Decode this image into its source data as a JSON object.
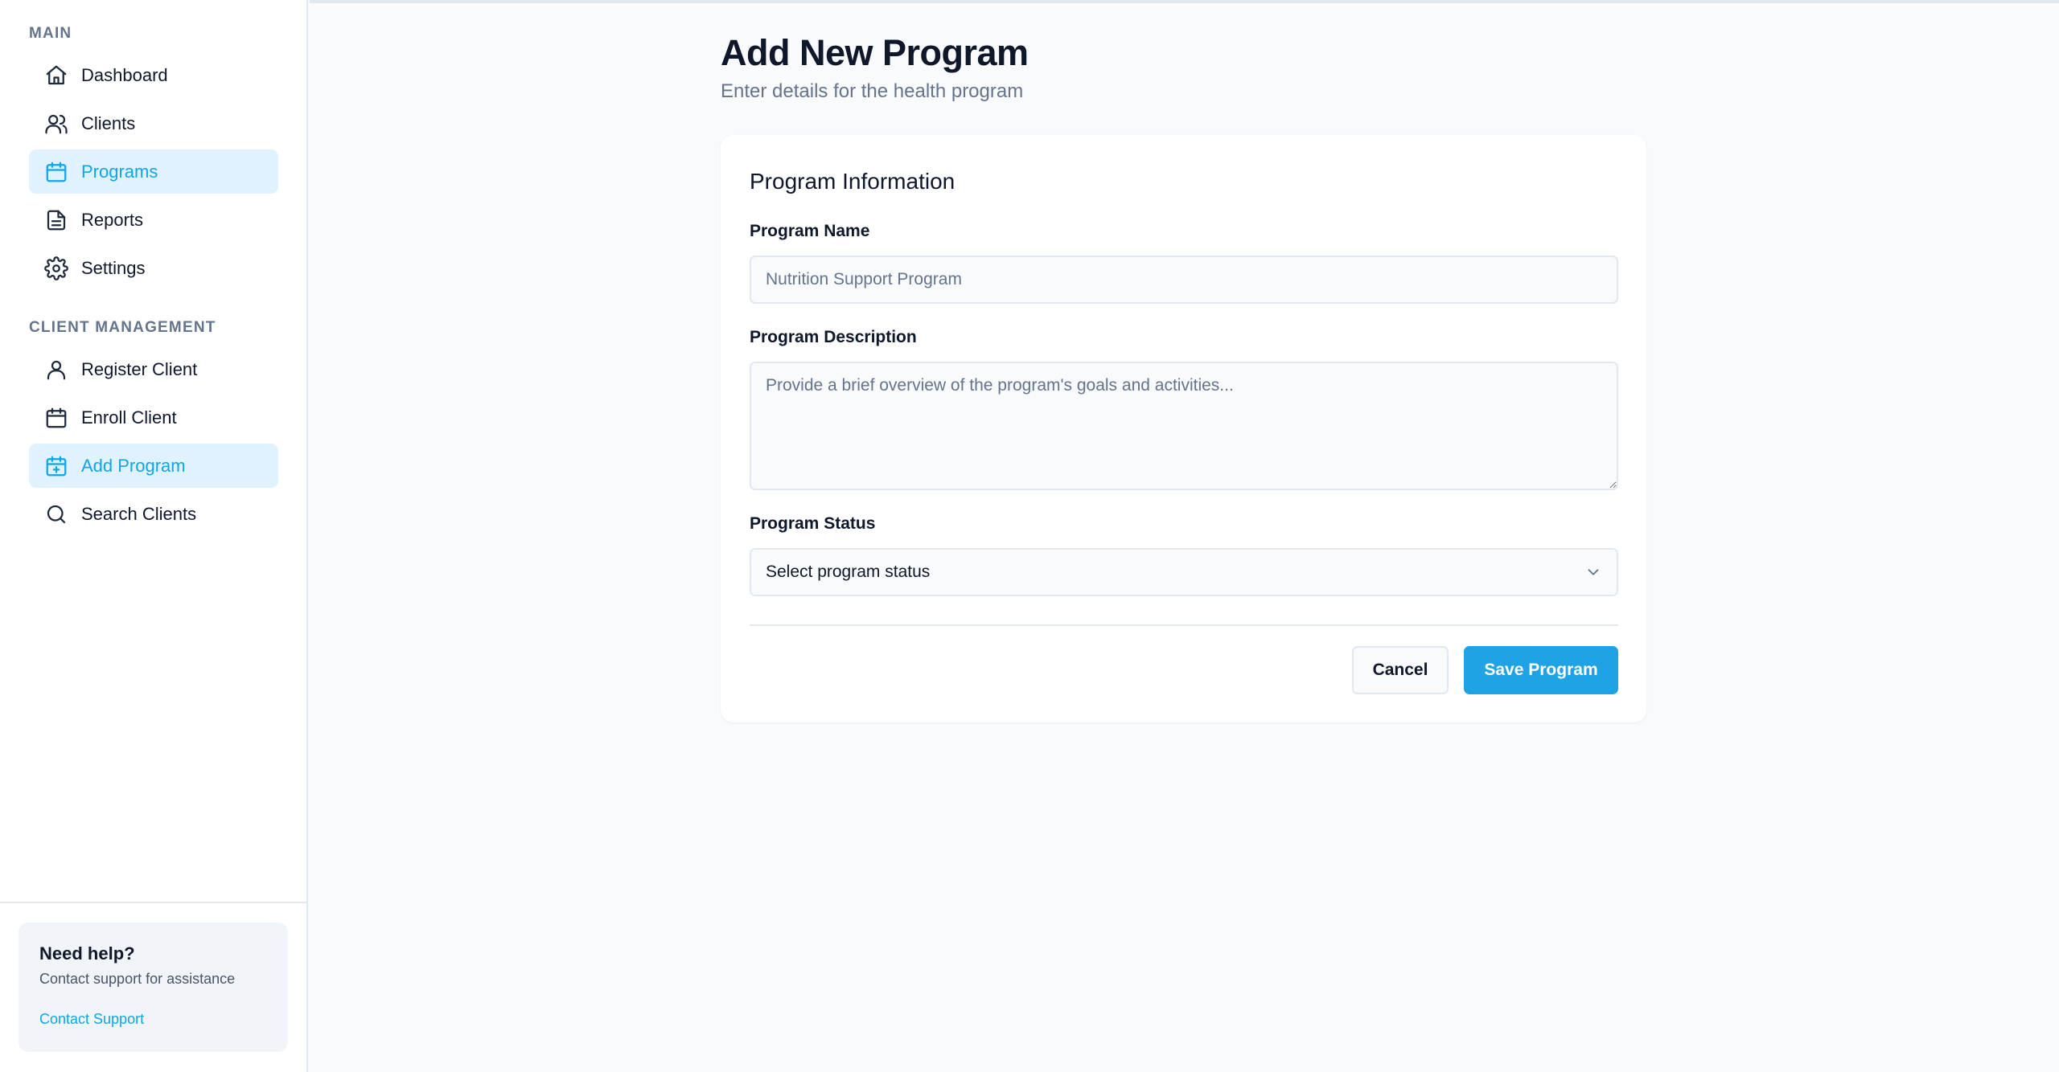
{
  "sidebar": {
    "sections": [
      {
        "title": "MAIN",
        "items": [
          {
            "label": "Dashboard",
            "icon": "home-icon",
            "active": false
          },
          {
            "label": "Clients",
            "icon": "users-icon",
            "active": false
          },
          {
            "label": "Programs",
            "icon": "calendar-icon",
            "active": true
          },
          {
            "label": "Reports",
            "icon": "document-icon",
            "active": false
          },
          {
            "label": "Settings",
            "icon": "gear-icon",
            "active": false
          }
        ]
      },
      {
        "title": "CLIENT MANAGEMENT",
        "items": [
          {
            "label": "Register Client",
            "icon": "user-icon",
            "active": false
          },
          {
            "label": "Enroll Client",
            "icon": "calendar-icon",
            "active": false
          },
          {
            "label": "Add Program",
            "icon": "calendar-plus-icon",
            "active": true
          },
          {
            "label": "Search Clients",
            "icon": "search-icon",
            "active": false
          }
        ]
      }
    ],
    "help": {
      "title": "Need help?",
      "text": "Contact support for assistance",
      "link": "Contact Support"
    }
  },
  "page": {
    "title": "Add New Program",
    "subtitle": "Enter details for the health program"
  },
  "form": {
    "card_title": "Program Information",
    "name_label": "Program Name",
    "name_placeholder": "Nutrition Support Program",
    "name_value": "",
    "description_label": "Program Description",
    "description_placeholder": "Provide a brief overview of the program's goals and activities...",
    "description_value": "",
    "status_label": "Program Status",
    "status_value": "Select program status",
    "cancel_label": "Cancel",
    "save_label": "Save Program"
  },
  "colors": {
    "accent": "#0ea5e9",
    "accent_bg": "#e0f2fe",
    "primary_button": "#1fa3e4",
    "background": "#f8fafc"
  }
}
